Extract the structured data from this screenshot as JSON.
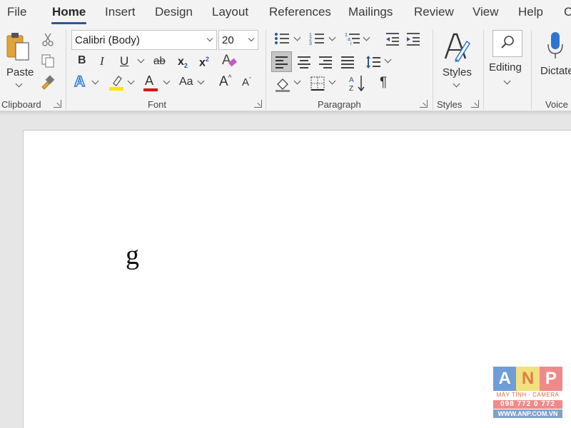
{
  "menu_tabs": [
    "File",
    "Home",
    "Insert",
    "Design",
    "Layout",
    "References",
    "Mailings",
    "Review",
    "View",
    "Help",
    "C"
  ],
  "active_tab": "Home",
  "clipboard": {
    "paste_label": "Paste",
    "group_label": "Clipboard"
  },
  "font": {
    "font_name": "Calibri (Body)",
    "font_size": "20",
    "bold": "B",
    "italic": "I",
    "underline": "U",
    "strikethrough": "ab",
    "subscript": "x",
    "subscript_mark": "2",
    "superscript": "x",
    "superscript_mark": "2",
    "case": "Aa",
    "grow": "A",
    "shrink": "A",
    "text_effects": "A",
    "font_color": "A",
    "clear": "A",
    "group_label": "Font",
    "highlight_color": "#ffe600",
    "font_color_value": "#e00000"
  },
  "paragraph": {
    "group_label": "Paragraph",
    "pilcrow": "¶"
  },
  "styles": {
    "label": "Styles",
    "group_label": "Styles"
  },
  "editing": {
    "label": "Editing"
  },
  "voice": {
    "dictate_label": "Dictate",
    "group_label": "Voice"
  },
  "document": {
    "text": "g"
  },
  "watermark": {
    "letters": [
      "A",
      "N",
      "P"
    ],
    "subtitle": "MÁY TÍNH · CAMERA",
    "phone": "098 772 0 772",
    "website": "WWW.ANP.COM.VN"
  }
}
